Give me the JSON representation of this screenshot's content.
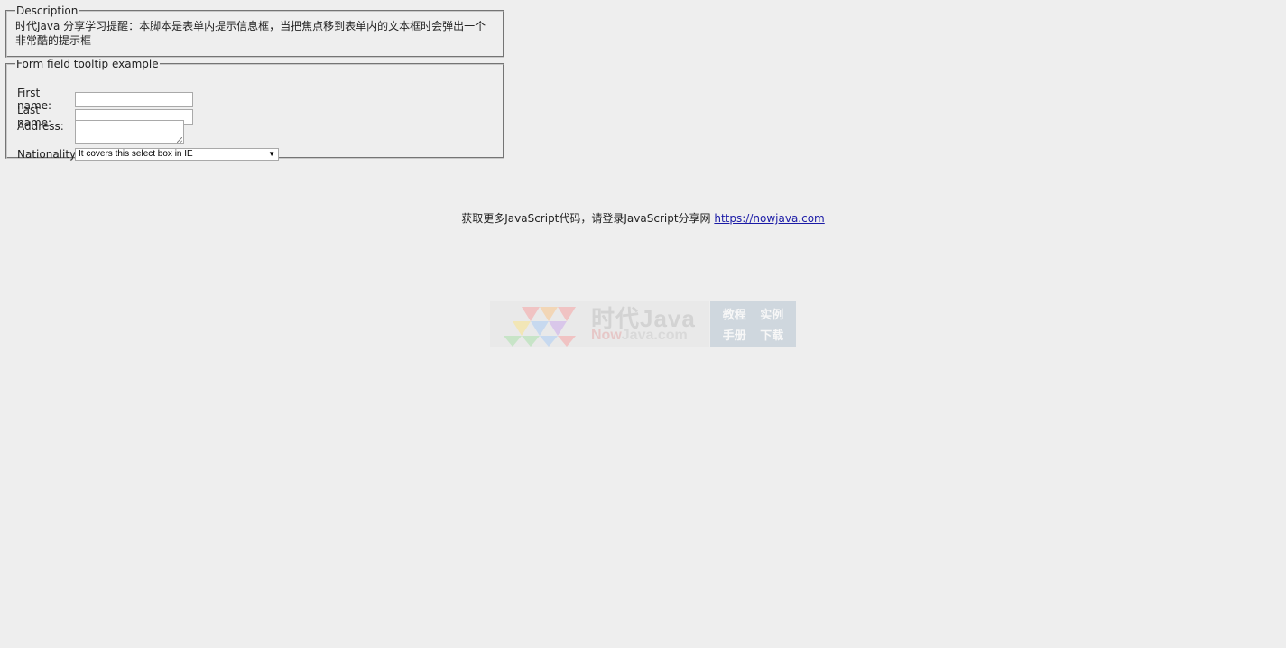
{
  "description": {
    "legend": "Description",
    "text": "时代Java 分享学习提醒：本脚本是表单内提示信息框，当把焦点移到表单内的文本框时会弹出一个非常酷的提示框"
  },
  "form": {
    "legend": "Form field tooltip example",
    "first_name_label": "First name:",
    "first_name_value": "",
    "last_name_label": "Last name:",
    "last_name_value": "",
    "address_label": "Address:",
    "address_value": "",
    "nationality_label": "Nationality",
    "nationality_selected": "It covers this select box in IE"
  },
  "footer": {
    "text": "获取更多JavaScript代码，请登录JavaScript分享网",
    "link": "https://nowjava.com"
  },
  "watermark": {
    "title": "时代Java",
    "sub_now": "Now",
    "sub_rest": "Java.com",
    "tags": [
      "教程",
      "实例",
      "手册",
      "下载"
    ]
  }
}
